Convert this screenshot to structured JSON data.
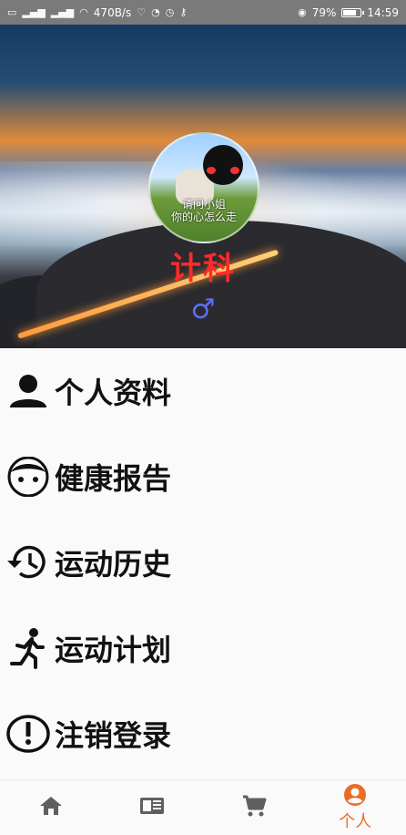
{
  "status_bar": {
    "left_icons": [
      "sim-icon",
      "signal-icon",
      "signal-icon-2",
      "wifi-icon"
    ],
    "net_speed": "470B/s",
    "eye_icon": "eye-icon",
    "battery_percent": "79%",
    "battery_level": 0.79,
    "time": "14:59"
  },
  "profile": {
    "avatar_caption_line1": "请问小姐",
    "avatar_caption_line2": "你的心怎么走",
    "username": "计科",
    "gender_symbol": "♂"
  },
  "menu": [
    {
      "label": "个人资料",
      "icon": "person-icon"
    },
    {
      "label": "健康报告",
      "icon": "face-icon"
    },
    {
      "label": "运动历史",
      "icon": "history-icon"
    },
    {
      "label": "运动计划",
      "icon": "run-icon"
    },
    {
      "label": "注销登录",
      "icon": "alert-icon"
    }
  ],
  "bottom_nav": {
    "items": [
      {
        "icon": "home-icon"
      },
      {
        "icon": "book-icon"
      },
      {
        "icon": "cart-icon"
      },
      {
        "icon": "account-icon",
        "label": "个人",
        "active": true
      }
    ],
    "accent_color": "#ea6c27"
  }
}
